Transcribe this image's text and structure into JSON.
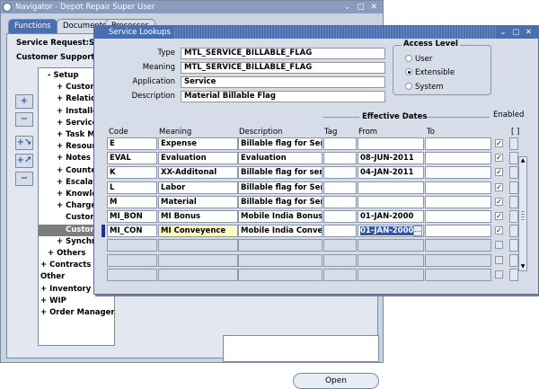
{
  "navigator": {
    "title": "Navigator - Depot Repair Super User",
    "tabs": [
      "Functions",
      "Documents",
      "Processes"
    ],
    "service_request_label": "Service Request:Setup",
    "customer_support_label": "Customer Support Lookups",
    "tree": [
      {
        "text": "- Setup",
        "indent": 0,
        "selected": false
      },
      {
        "text": "+ Customer",
        "indent": 1,
        "selected": false
      },
      {
        "text": "+ Relations",
        "indent": 1,
        "selected": false
      },
      {
        "text": "+ Installed",
        "indent": 1,
        "selected": false
      },
      {
        "text": "+ Service R",
        "indent": 1,
        "selected": false
      },
      {
        "text": "+ Task Man",
        "indent": 1,
        "selected": false
      },
      {
        "text": "+ Resource",
        "indent": 1,
        "selected": false
      },
      {
        "text": "+ Notes",
        "indent": 1,
        "selected": false
      },
      {
        "text": "+ Counters",
        "indent": 1,
        "selected": false
      },
      {
        "text": "+ Escalatio",
        "indent": 1,
        "selected": false
      },
      {
        "text": "+ Knowled",
        "indent": 1,
        "selected": false
      },
      {
        "text": "+ Charges",
        "indent": 1,
        "selected": false
      },
      {
        "text": "Customer",
        "indent": 2,
        "selected": false
      },
      {
        "text": "Custome",
        "indent": 2,
        "selected": true
      },
      {
        "text": "+ Synchror",
        "indent": 1,
        "selected": false
      },
      {
        "text": "+ Others",
        "indent": 0,
        "selected": false
      },
      {
        "text": "+ Contracts",
        "indent": -1,
        "selected": false
      },
      {
        "text": "Other",
        "indent": -1,
        "selected": false
      },
      {
        "text": "+ Inventory",
        "indent": -1,
        "selected": false
      },
      {
        "text": "+ WIP",
        "indent": -1,
        "selected": false
      },
      {
        "text": "+ Order Management",
        "indent": -1,
        "selected": false
      }
    ],
    "open_button": "Open"
  },
  "lookups": {
    "title": "Service Lookups",
    "type_label": "Type",
    "type_value": "MTL_SERVICE_BILLABLE_FLAG",
    "meaning_label": "Meaning",
    "meaning_value": "MTL_SERVICE_BILLABLE_FLAG",
    "application_label": "Application",
    "application_value": "Service",
    "description_label": "Description",
    "description_value": "Material Billable Flag",
    "access_level": {
      "title": "Access Level",
      "options": [
        "User",
        "Extensible",
        "System"
      ],
      "selected": "Extensible"
    },
    "effective_dates_label": "Effective Dates",
    "enabled_label": "Enabled",
    "columns": {
      "code": "Code",
      "meaning": "Meaning",
      "description": "Description",
      "tag": "Tag",
      "from": "From",
      "to": "To"
    },
    "rows": [
      {
        "code": "E",
        "meaning": "Expense",
        "description": "Billable flag for Servic",
        "tag": "",
        "from": "",
        "to": "",
        "enabled": true
      },
      {
        "code": "EVAL",
        "meaning": "Evaluation",
        "description": "Evaluation",
        "tag": "",
        "from": "08-JUN-2011",
        "to": "",
        "enabled": true
      },
      {
        "code": "K",
        "meaning": "XX-Additonal",
        "description": "Billable flag for servic",
        "tag": "",
        "from": "04-JAN-2011",
        "to": "",
        "enabled": true
      },
      {
        "code": "L",
        "meaning": "Labor",
        "description": "Billable flag for Servic",
        "tag": "",
        "from": "",
        "to": "",
        "enabled": true
      },
      {
        "code": "M",
        "meaning": "Material",
        "description": "Billable flag for Servic",
        "tag": "",
        "from": "",
        "to": "",
        "enabled": true
      },
      {
        "code": "MI_BON",
        "meaning": "MI Bonus",
        "description": "Mobile India Bonus",
        "tag": "",
        "from": "01-JAN-2000",
        "to": "",
        "enabled": true
      },
      {
        "code": "MI_CON",
        "meaning": "MI Conveyence",
        "description": "Mobile India Conveye",
        "tag": "",
        "from": "01-JAN-2000",
        "to": "",
        "enabled": true,
        "current": true
      },
      {
        "code": "",
        "meaning": "",
        "description": "",
        "tag": "",
        "from": "",
        "to": "",
        "enabled": false
      },
      {
        "code": "",
        "meaning": "",
        "description": "",
        "tag": "",
        "from": "",
        "to": "",
        "enabled": false
      },
      {
        "code": "",
        "meaning": "",
        "description": "",
        "tag": "",
        "from": "",
        "to": "",
        "enabled": false
      }
    ],
    "flexfield_label": "[ ]"
  }
}
